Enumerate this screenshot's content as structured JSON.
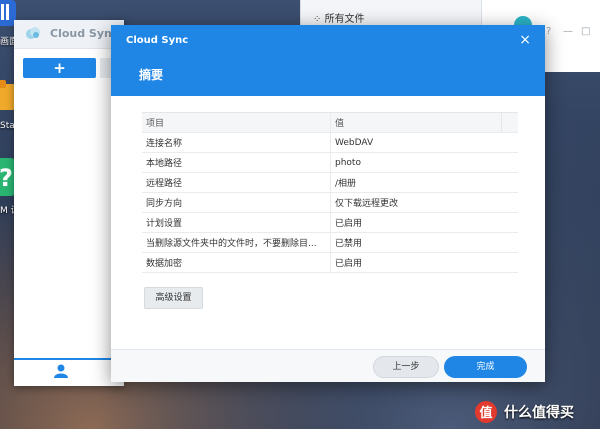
{
  "desktop": {
    "labels": [
      "画面",
      "Stat",
      "M 设"
    ]
  },
  "bg_window": {
    "item_label": "所有文件",
    "controls": [
      "?",
      "—",
      "□"
    ]
  },
  "cloud_sync_window": {
    "title": "Cloud Sync",
    "add_label": "+"
  },
  "dialog": {
    "title": "Cloud Sync",
    "close_label": "×",
    "heading": "摘要",
    "table": {
      "header_key": "项目",
      "header_value": "值",
      "rows": [
        {
          "key": "连接名称",
          "value": "WebDAV"
        },
        {
          "key": "本地路径",
          "value": "photo"
        },
        {
          "key": "远程路径",
          "value": "/相册"
        },
        {
          "key": "同步方向",
          "value": "仅下载远程更改"
        },
        {
          "key": "计划设置",
          "value": "已启用"
        },
        {
          "key": "当删除源文件夹中的文件时，不要删除目...",
          "value": "已禁用"
        },
        {
          "key": "数据加密",
          "value": "已启用"
        }
      ]
    },
    "advanced_label": "高级设置",
    "prev_label": "上一步",
    "done_label": "完成"
  },
  "watermark": {
    "text": "什么值得买",
    "logo_char": "值"
  },
  "colors": {
    "accent": "#1f86e6",
    "header_bg": "#f4f6f8"
  }
}
